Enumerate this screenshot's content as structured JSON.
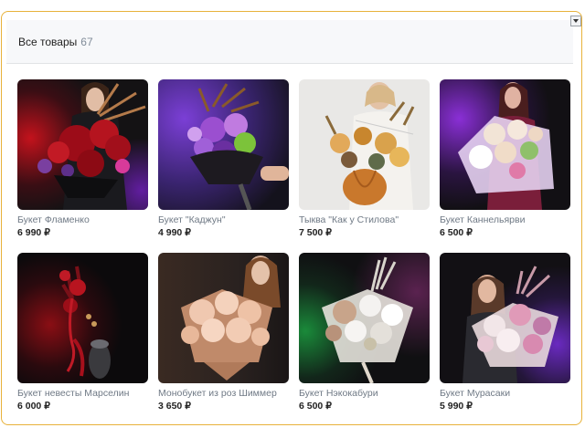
{
  "header": {
    "title": "Все товары",
    "count": "67"
  },
  "products": [
    {
      "name": "Букет Фламенко",
      "price": "6 990 ₽",
      "image": "flamenco-bouquet"
    },
    {
      "name": "Букет \"Каджун\"",
      "price": "4 990 ₽",
      "image": "cajun-bouquet"
    },
    {
      "name": "Тыква \"Как у Стилова\"",
      "price": "7 500 ₽",
      "image": "pumpkin-arrangement"
    },
    {
      "name": "Букет Каннельярви",
      "price": "6 500 ₽",
      "image": "kannelyarvi-bouquet"
    },
    {
      "name": "Букет невесты Марселин",
      "price": "6 000 ₽",
      "image": "marseline-bridal-bouquet"
    },
    {
      "name": "Монобукет из роз Шиммер",
      "price": "3 650 ₽",
      "image": "shimmer-rose-bouquet"
    },
    {
      "name": "Букет Нэкокабури",
      "price": "6 500 ₽",
      "image": "nekokaburi-bouquet"
    },
    {
      "name": "Букет Мурасаки",
      "price": "5 990 ₽",
      "image": "murasaki-bouquet"
    }
  ]
}
